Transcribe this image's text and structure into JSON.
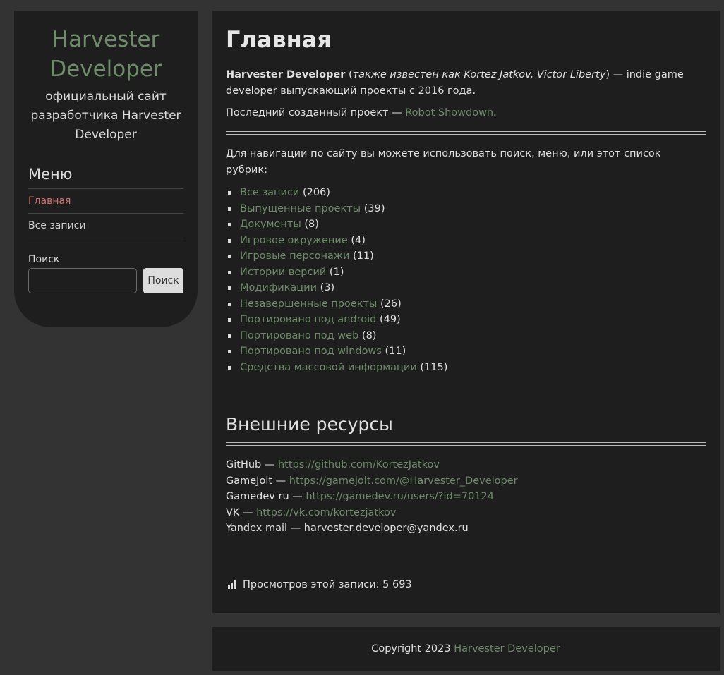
{
  "sidebar": {
    "site_title": "Harvester Developer",
    "site_description": "официальный сайт разработчика Harvester Developer",
    "menu_title": "Меню",
    "menu_items": [
      {
        "label": "Главная",
        "active": true
      },
      {
        "label": "Все записи",
        "active": false
      }
    ],
    "search_label": "Поиск",
    "search_value": "",
    "search_button": "Поиск"
  },
  "main": {
    "title": "Главная",
    "intro": {
      "name": "Harvester Developer",
      "paren_open": " (",
      "aka": "также известен как Kortez Jatkov, Victor Liberty",
      "rest": ") — indie game developer выпускающий проекты с 2016 года."
    },
    "last_project": {
      "prefix": "Последний созданный проект — ",
      "link": "Robot Showdown",
      "suffix": "."
    },
    "nav_text": "Для навигации по сайту вы можете использовать поиск, меню, или этот список рубрик:",
    "categories": [
      {
        "label": "Все записи",
        "count": "(206)"
      },
      {
        "label": "Выпущенные проекты",
        "count": "(39)"
      },
      {
        "label": "Документы",
        "count": "(8)"
      },
      {
        "label": "Игровое окружение",
        "count": "(4)"
      },
      {
        "label": "Игровые персонажи",
        "count": "(11)"
      },
      {
        "label": "Истории версий",
        "count": "(1)"
      },
      {
        "label": "Модификации",
        "count": "(3)"
      },
      {
        "label": "Незавершенные проекты",
        "count": "(26)"
      },
      {
        "label": "Портировано под android",
        "count": "(49)"
      },
      {
        "label": "Портировано под web",
        "count": "(8)"
      },
      {
        "label": "Портировано под windows",
        "count": "(11)"
      },
      {
        "label": "Средства массовой информации",
        "count": "(115)"
      }
    ],
    "resources_title": "Внешние ресурсы",
    "resources": [
      {
        "name": "GitHub — ",
        "link": "https://github.com/KortezJatkov"
      },
      {
        "name": "GameJolt — ",
        "link": "https://gamejolt.com/@Harvester_Developer"
      },
      {
        "name": "Gamedev ru — ",
        "link": "https://gamedev.ru/users/?id=70124"
      },
      {
        "name": "VK — ",
        "link": "https://vk.com/kortezjatkov"
      },
      {
        "name": "Yandex mail — ",
        "text": "harvester.developer@yandex.ru"
      }
    ],
    "views": "Просмотров этой записи: 5 693"
  },
  "footer": {
    "prefix": "Copyright 2023 ",
    "link": "Harvester Developer"
  },
  "colors": {
    "background": "#333333",
    "panel": "#1e1e1e",
    "link": "#6e8b6a",
    "active_menu": "#d36f6c"
  }
}
